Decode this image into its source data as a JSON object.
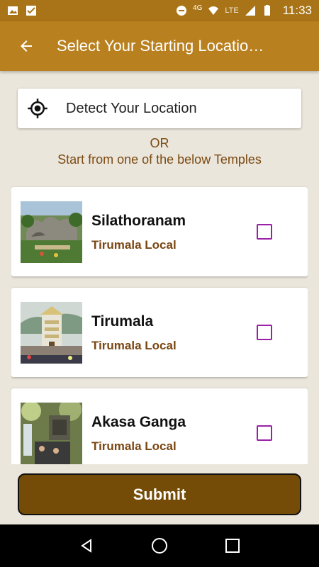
{
  "status_bar": {
    "time": "11:33",
    "network_label": "LTE",
    "data_label": "4G",
    "icons": [
      "image-icon",
      "check-badge-icon",
      "do-not-disturb-icon",
      "wifi-icon",
      "signal-icon",
      "battery-icon"
    ]
  },
  "app_bar": {
    "title": "Select Your Starting Locatio…",
    "back_icon": "arrow-back-icon"
  },
  "detect": {
    "label": "Detect Your Location",
    "icon": "gps-target-icon"
  },
  "or_text": "OR",
  "start_text": "Start from one of the below Temples",
  "temples": [
    {
      "name": "Silathoranam",
      "subtitle": "Tirumala Local",
      "checked": false
    },
    {
      "name": "Tirumala",
      "subtitle": "Tirumala Local",
      "checked": false
    },
    {
      "name": "Akasa Ganga",
      "subtitle": "Tirumala Local",
      "checked": false
    }
  ],
  "submit_label": "Submit",
  "colors": {
    "status_bar": "#a97417",
    "app_bar": "#b8801f",
    "background": "#ebe6dc",
    "accent_text": "#7a4a12",
    "checkbox": "#9b1fa7",
    "submit": "#744c08"
  },
  "nav": [
    "back-triangle-icon",
    "home-circle-icon",
    "recents-square-icon"
  ]
}
